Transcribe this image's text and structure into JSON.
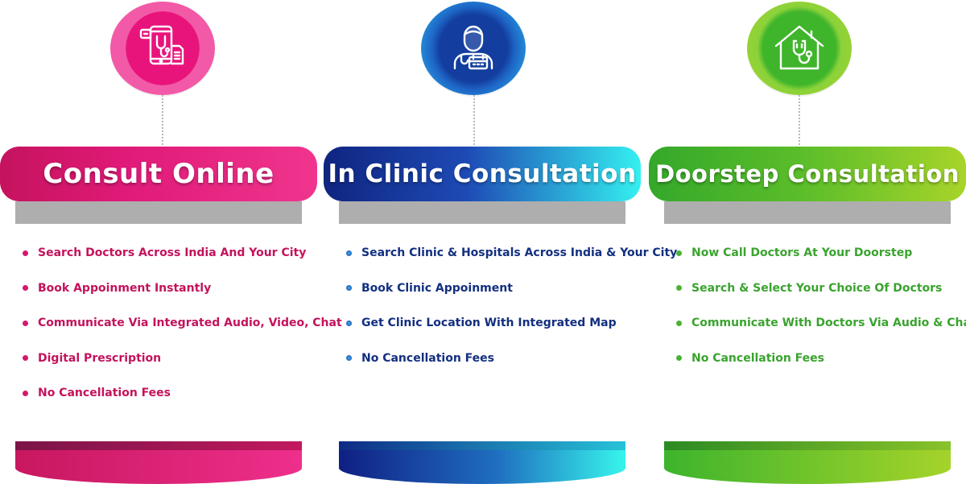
{
  "cards": [
    {
      "title": "Consult Online",
      "icon": "mobile-stethoscope-icon",
      "accent": "#e01a78",
      "points": [
        "Search Doctors Across India And Your City",
        "Book Appoinment Instantly",
        "Communicate Via Integrated Audio, Video, Chat",
        "Digital Prescription",
        "No Cancellation Fees"
      ]
    },
    {
      "title": "In Clinic Consultation",
      "icon": "doctor-calendar-icon",
      "accent": "#1e4ab5",
      "points": [
        "Search Clinic & Hospitals Across India & Your City",
        "Book Clinic Appoinment",
        "Get Clinic Location With Integrated Map",
        "No Cancellation Fees"
      ]
    },
    {
      "title": "Doorstep Consultation",
      "icon": "house-stethoscope-icon",
      "accent": "#5dbe2a",
      "points": [
        "Now Call Doctors At Your Doorstep",
        "Search & Select Your Choice Of Doctors",
        "Communicate With Doctors Via Audio & Chat",
        "No Cancellation Fees"
      ]
    }
  ]
}
